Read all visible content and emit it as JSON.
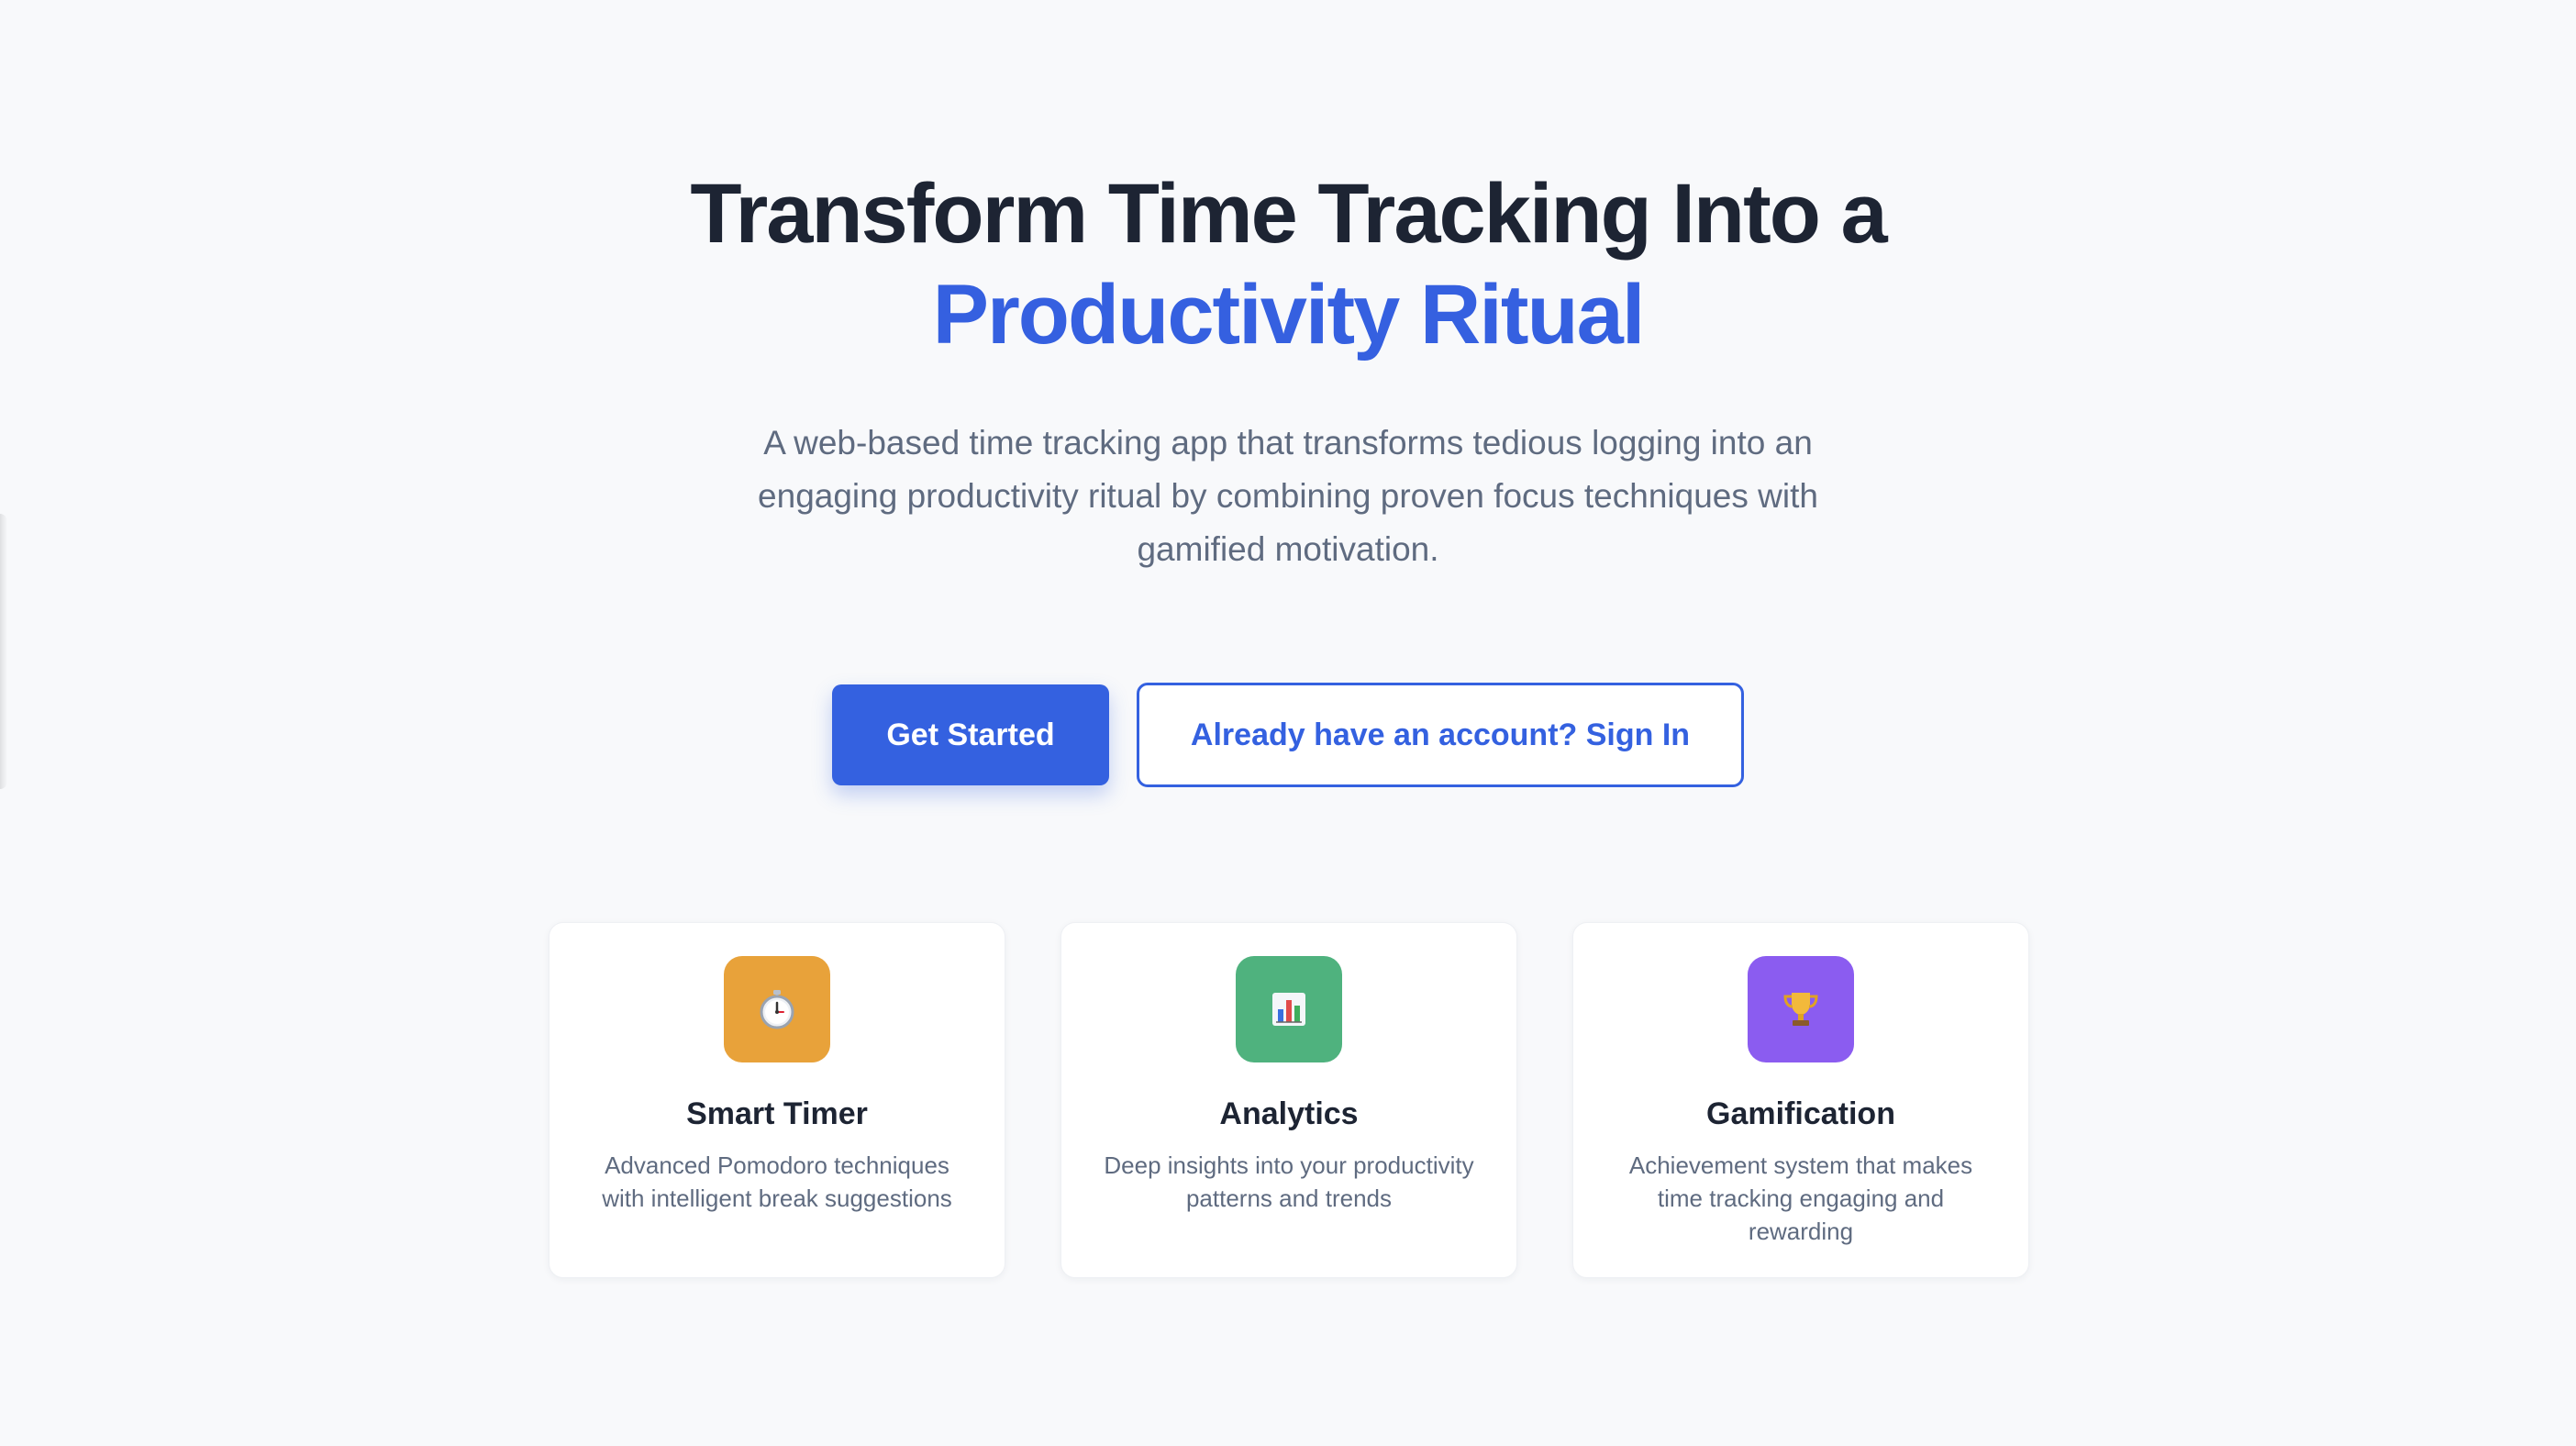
{
  "hero": {
    "title_line1": "Transform Time Tracking Into a",
    "title_line2": "Productivity Ritual",
    "subtitle": "A web-based time tracking app that transforms tedious logging into an engaging productivity ritual by combining proven focus techniques with gamified motivation."
  },
  "cta": {
    "primary_label": "Get Started",
    "secondary_label": "Already have an account? Sign In"
  },
  "features": [
    {
      "title": "Smart Timer",
      "description": "Advanced Pomodoro techniques with intelligent break suggestions",
      "icon": "stopwatch-icon",
      "color": "#e8a23a"
    },
    {
      "title": "Analytics",
      "description": "Deep insights into your productivity patterns and trends",
      "icon": "bar-chart-icon",
      "color": "#4fb27e"
    },
    {
      "title": "Gamification",
      "description": "Achievement system that makes time tracking engaging and rewarding",
      "icon": "trophy-icon",
      "color": "#8b5cf0"
    }
  ],
  "colors": {
    "accent": "#3461e0",
    "heading": "#1d2433",
    "body_text": "#5f6b80",
    "background": "#f8f9fb"
  }
}
